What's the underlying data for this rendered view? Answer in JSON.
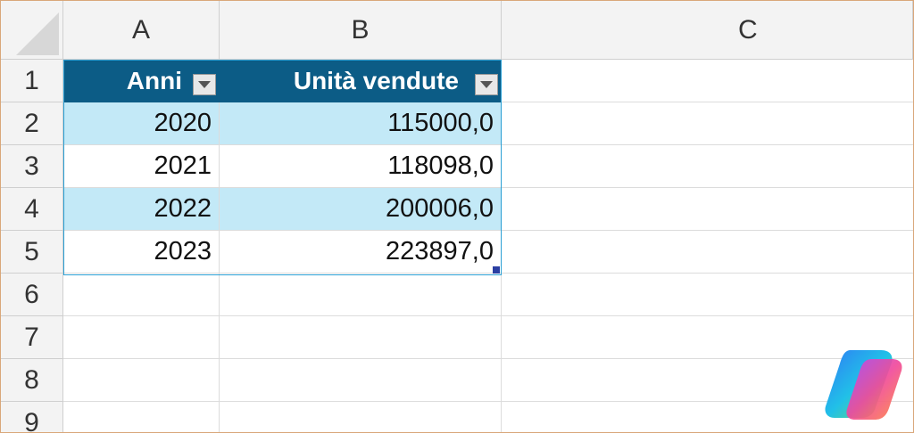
{
  "columns": [
    "A",
    "B",
    "C"
  ],
  "rows": [
    "1",
    "2",
    "3",
    "4",
    "5",
    "6",
    "7",
    "8",
    "9"
  ],
  "table": {
    "headers": [
      "Anni",
      "Unità vendute"
    ],
    "data": [
      [
        "2020",
        "115000,0"
      ],
      [
        "2021",
        "118098,0"
      ],
      [
        "2022",
        "200006,0"
      ],
      [
        "2023",
        "223897,0"
      ]
    ]
  },
  "colors": {
    "header_bg": "#0c5c86",
    "band_bg": "#c3e9f7",
    "table_border": "#2a9fd4"
  },
  "icons": {
    "filter": "dropdown-filter-icon",
    "logo": "copilot-logo-icon"
  }
}
